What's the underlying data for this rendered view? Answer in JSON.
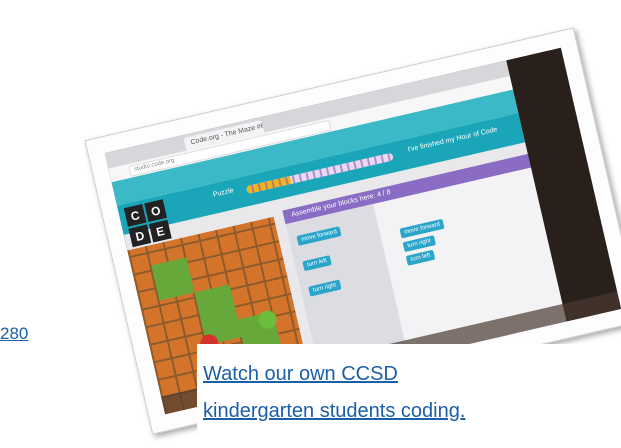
{
  "side_link": {
    "text": "280"
  },
  "photo": {
    "browser_tab": "Code.org - The Maze #6",
    "address": "studio.code.org",
    "logo_letters": [
      "C",
      "O",
      "D",
      "E"
    ],
    "puzzle_label": "Puzzle",
    "finished_label": "I've finished my Hour of Code",
    "workspace_header": "Assemble your blocks here: 4 / 8",
    "blocks": [
      "move forward",
      "turn left",
      "turn right",
      "move forward",
      "turn right",
      "turn left"
    ],
    "progress_fraction": 0.3
  },
  "caption": {
    "line1": "Watch our own CCSD",
    "line2": "kindergarten students coding."
  }
}
